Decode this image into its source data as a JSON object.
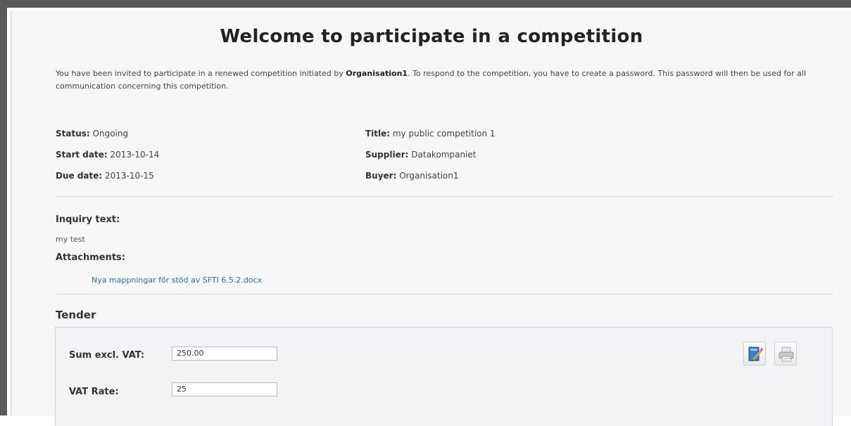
{
  "page": {
    "title": "Welcome to participate in a competition",
    "intro_prefix": "You have been invited to participate in a renewed competition initiated by ",
    "intro_org": "Organisation1",
    "intro_suffix": ". To respond to the competition, you have to create a password. This password will then be used for all communication concerning this competition."
  },
  "details": {
    "status_label": "Status:",
    "status_value": "Ongoing",
    "start_label": "Start date:",
    "start_value": "2013-10-14",
    "due_label": "Due date:",
    "due_value": "2013-10-15",
    "title_label": "Title:",
    "title_value": "my public competition 1",
    "supplier_label": "Supplier:",
    "supplier_value": "Datakompaniet",
    "buyer_label": "Buyer:",
    "buyer_value": "Organisation1"
  },
  "inquiry": {
    "label": "Inquiry text:",
    "text": "my test",
    "attachments_label": "Attachments:",
    "attachment_link": "Nya mappningar för stöd av SFTI 6.5.2.docx"
  },
  "tender": {
    "section_title": "Tender",
    "sum_label": "Sum excl. VAT:",
    "sum_value": "250.00",
    "vat_label": "VAT Rate:",
    "vat_value": "25"
  },
  "icons": {
    "edit": "edit-document-icon",
    "print": "printer-icon"
  },
  "colors": {
    "link": "#2a6db3",
    "frame": "#5a5a5a"
  }
}
